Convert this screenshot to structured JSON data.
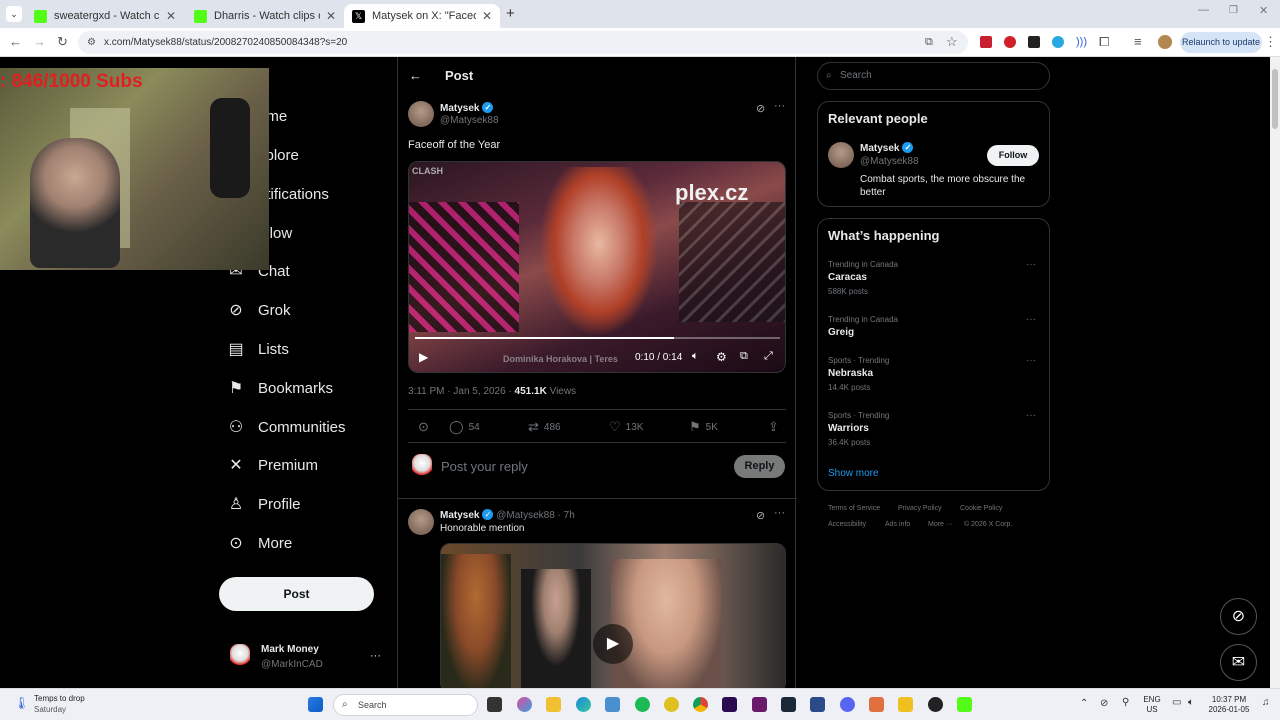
{
  "browser": {
    "tabs": [
      {
        "title": "sweatergxd - Watch clips on Kick",
        "favicon_color": "#53fc18"
      },
      {
        "title": "Dharris - Watch clips on Kick",
        "favicon_color": "#53fc18"
      },
      {
        "title": "Matysek on X: \"Faceoff of the Year\"",
        "favicon_color": "#000000",
        "active": true
      }
    ],
    "new_tab": "+",
    "url": "x.com/Matysek88/status/2008270240850084348?s=20",
    "relaunch_label": "Relaunch to update"
  },
  "stream_overlay": {
    "subs_text": ": 846/1000  Subs"
  },
  "nav": {
    "items": [
      {
        "label": "ome",
        "icon": "home-icon"
      },
      {
        "label": "xplore",
        "icon": "search-icon"
      },
      {
        "label": "otifications",
        "icon": "bell-icon"
      },
      {
        "label": "ollow",
        "icon": "person-add-icon"
      },
      {
        "label": "Chat",
        "icon": "mail-icon"
      },
      {
        "label": "Grok",
        "icon": "grok-icon"
      },
      {
        "label": "Lists",
        "icon": "list-icon"
      },
      {
        "label": "Bookmarks",
        "icon": "bookmark-icon"
      },
      {
        "label": "Communities",
        "icon": "people-icon"
      },
      {
        "label": "Premium",
        "icon": "x-logo-icon"
      },
      {
        "label": "Profile",
        "icon": "person-icon"
      },
      {
        "label": "More",
        "icon": "more-circle-icon"
      }
    ],
    "post_label": "Post",
    "account": {
      "name": "Mark Money",
      "handle": "@MarkInCAD",
      "more": "···"
    }
  },
  "main": {
    "header_title": "Post",
    "post": {
      "author": "Matysek",
      "handle": "@Matysek88",
      "text": "Faceoff of the Year",
      "video": {
        "watermark": "CLASH",
        "banner_text": "plex.cz",
        "caption": "Dominika Horakova | Teres",
        "time": "0:10 / 0:14",
        "progress": 0.71
      },
      "timestamp": "3:11 PM · Jan 5, 2026 ·",
      "views_count": "451.1K",
      "views_label": "Views",
      "stats": {
        "replies": "54",
        "reposts": "486",
        "likes": "13K",
        "bookmarks": "5K"
      }
    },
    "reply_box": {
      "placeholder": "Post your reply",
      "button": "Reply"
    },
    "reply": {
      "author": "Matysek",
      "handle": "@Matysek88",
      "time": "· 7h",
      "text": "Honorable mention"
    }
  },
  "sidebar": {
    "search_placeholder": "Search",
    "relevant": {
      "title": "Relevant people",
      "name": "Matysek",
      "handle": "@Matysek88",
      "follow": "Follow",
      "bio": "Combat sports, the more obscure the better"
    },
    "happening": {
      "title": "What’s happening",
      "trends": [
        {
          "meta": "Trending in Canada",
          "name": "Caracas",
          "count": "588K posts"
        },
        {
          "meta": "Trending in Canada",
          "name": "Greig",
          "count": ""
        },
        {
          "meta": "Sports · Trending",
          "name": "Nebraska",
          "count": "14.4K posts"
        },
        {
          "meta": "Sports · Trending",
          "name": "Warriors",
          "count": "36.4K posts"
        }
      ],
      "show_more": "Show more"
    },
    "footer": [
      "Terms of Service",
      "Privacy Policy",
      "Cookie Policy",
      "Accessibility",
      "Ads info",
      "More ···",
      "© 2026 X Corp."
    ]
  },
  "taskbar": {
    "weather_line1": "Temps to drop",
    "weather_line2": "Saturday",
    "search_label": "Search",
    "lang_line1": "ENG",
    "lang_line2": "US",
    "time": "10:37 PM",
    "date": "2026-01-05"
  },
  "colors": {
    "accent": "#1d9bf0",
    "kick": "#53fc18",
    "background": "#000000"
  }
}
